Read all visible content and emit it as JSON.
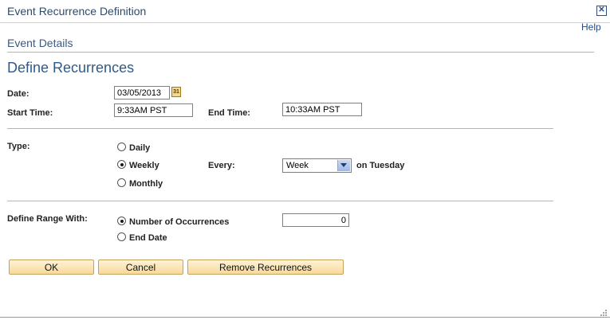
{
  "window": {
    "title": "Event Recurrence Definition",
    "help_label": "Help"
  },
  "section": {
    "title": "Event Details"
  },
  "page": {
    "title": "Define Recurrences"
  },
  "form": {
    "date_label": "Date:",
    "date_value": "03/05/2013",
    "calendar_icon_text": "31",
    "start_label": "Start Time:",
    "start_value": "9:33AM PST",
    "end_label": "End Time:",
    "end_value": "10:33AM PST",
    "type_label": "Type:",
    "type_options": [
      "Daily",
      "Weekly",
      "Monthly"
    ],
    "type_selected": "Weekly",
    "every_label": "Every:",
    "every_value": "Week",
    "every_suffix": "on Tuesday",
    "range_label": "Define Range With:",
    "range_options": [
      "Number of Occurrences",
      "End Date"
    ],
    "range_selected": "Number of Occurrences",
    "occurrences_value": "0"
  },
  "buttons": {
    "ok": "OK",
    "cancel": "Cancel",
    "remove": "Remove Recurrences"
  }
}
